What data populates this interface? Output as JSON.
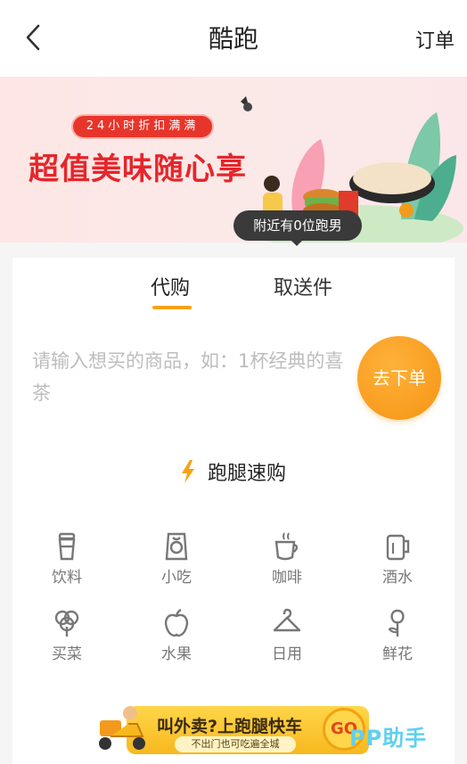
{
  "header": {
    "title": "酷跑",
    "right_action": "订单"
  },
  "banner": {
    "pill": "24小时折扣满满",
    "slogan": "超值美味随心享"
  },
  "tooltip": "附近有0位跑男",
  "tabs": [
    {
      "label": "代购",
      "active": true
    },
    {
      "label": "取送件",
      "active": false
    }
  ],
  "order": {
    "placeholder": "请输入想买的商品，如：1杯经典的喜茶",
    "button": "去下单"
  },
  "section": {
    "title": "跑腿速购"
  },
  "categories": [
    {
      "label": "饮料",
      "icon": "drink-cup-icon"
    },
    {
      "label": "小吃",
      "icon": "snack-bag-icon"
    },
    {
      "label": "咖啡",
      "icon": "coffee-cup-icon"
    },
    {
      "label": "酒水",
      "icon": "beer-mug-icon"
    },
    {
      "label": "买菜",
      "icon": "vegetable-icon"
    },
    {
      "label": "水果",
      "icon": "apple-icon"
    },
    {
      "label": "日用",
      "icon": "hanger-icon"
    },
    {
      "label": "鲜花",
      "icon": "flower-icon"
    }
  ],
  "promo": {
    "title": "叫外卖?上跑腿快车",
    "subtitle": "不出门也可吃遍全城",
    "go": "GO"
  },
  "watermark": "PP助手",
  "colors": {
    "accent": "#f7a21a",
    "brand_red": "#e5262b"
  }
}
